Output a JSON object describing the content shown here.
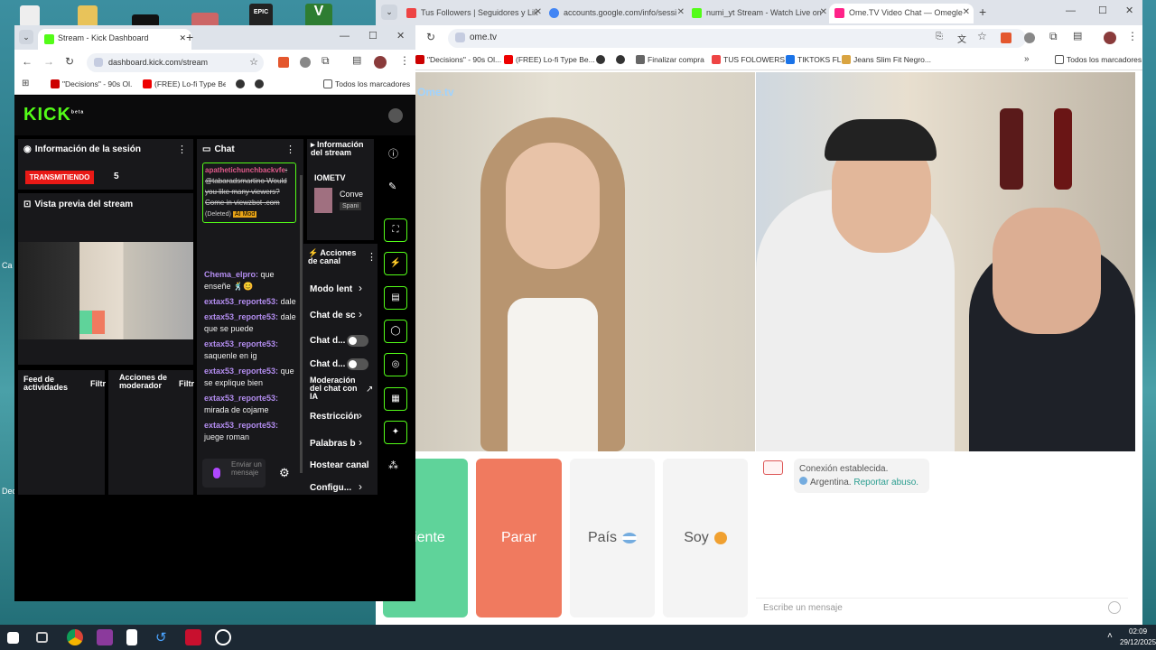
{
  "desktop": {
    "side_label_1": "Ca",
    "side_label_2": "Dec"
  },
  "right_browser": {
    "tabs": [
      {
        "label": "Tus Followers | Seguidores y Lik"
      },
      {
        "label": "accounts.google.com/info/sessi"
      },
      {
        "label": "numi_yt Stream - Watch Live on"
      },
      {
        "label": "Ome.TV Video Chat — Omegle"
      }
    ],
    "url": "ome.tv",
    "bookmarks": [
      "\"Decisions\" - 90s Ol...",
      "(FREE) Lo-fi Type Be...",
      "",
      "",
      "Finalizar compra",
      "TUS FOLOWERS",
      "TIKTOKS FL",
      "Jeans Slim Fit Negro...",
      "Todos los marcadores"
    ],
    "brand": "Ome.tv",
    "buttons": {
      "next": "uiente",
      "stop": "Parar",
      "country": "País",
      "gender": "Soy"
    },
    "chat": {
      "line1": "Conexión establecida.",
      "country": "Argentina.",
      "report": "Reportar abuso.",
      "placeholder": "Escribe un mensaje"
    },
    "accent_green": "#5fd39a",
    "accent_red": "#f07a5f"
  },
  "left_window": {
    "tab_title": "Stream - Kick Dashboard",
    "url": "dashboard.kick.com/stream",
    "bookmarks": [
      "\"Decisions\" - 90s Ol...",
      "(FREE) Lo-fi Type Be...",
      "",
      "",
      "Todos los marcadores"
    ],
    "logo": "KICK",
    "logo_sup": "beta",
    "session": {
      "title": "Información de la sesión",
      "live_badge": "TRANSMITIENDO",
      "viewers": "5"
    },
    "preview_title": "Vista previa del stream",
    "feed_title": "Feed de actividades",
    "feed_filter": "Filtr",
    "mod_title": "Acciones de moderador",
    "mod_filter": "Filtr",
    "chat": {
      "title": "Chat",
      "deleted_user": "apathetichunchbackvfe",
      "deleted_text": ": @tabaradsmartino Would you like many viewers? Come in viewzbot .com",
      "deleted_tag": "(Deleted)",
      "ai_tag": "AI Mod",
      "messages": [
        {
          "user": "Chema_elpro:",
          "text": "que enseñe 🕺😊"
        },
        {
          "user": "extax53_reporte53:",
          "text": "dale"
        },
        {
          "user": "extax53_reporte53:",
          "text": "dale que se puede"
        },
        {
          "user": "extax53_reporte53:",
          "text": "saquenle en ig"
        },
        {
          "user": "extax53_reporte53:",
          "text": "que se explique bien"
        },
        {
          "user": "extax53_reporte53:",
          "text": "mirada de cojame"
        },
        {
          "user": "extax53_reporte53:",
          "text": "juege roman"
        }
      ],
      "send_placeholder": "Enviar un mensaje"
    },
    "stream_info": {
      "title": "Información del stream",
      "channel": "IOMETV",
      "category": "Conve",
      "language": "Spani"
    },
    "channel_actions": {
      "title": "Acciones de canal",
      "items": [
        "Modo lent",
        "Chat de sc",
        "Chat d...",
        "Chat d...",
        "Moderación del chat con IA",
        "Restricción",
        "Palabras b",
        "Hostear canal",
        "Configu..."
      ]
    },
    "kick_green": "#53fc18"
  },
  "taskbar": {
    "time": "02:09",
    "date": "29/12/2025"
  }
}
